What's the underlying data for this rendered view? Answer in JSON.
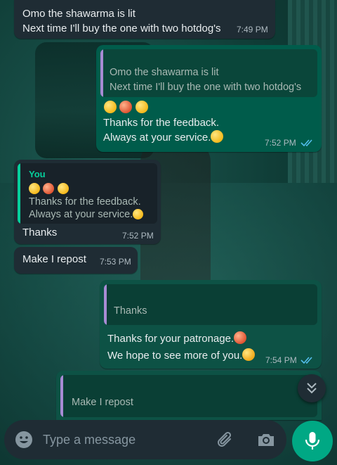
{
  "colors": {
    "incoming_bubble": "#1f2c34",
    "outgoing_bubble": "#005c4b",
    "quote_bar_purple": "#a78bd4",
    "quote_bar_teal": "#06cf9c",
    "read_ticks": "#53bdeb",
    "mic_button": "#00a884"
  },
  "messages": [
    {
      "id": "m1",
      "direction": "incoming",
      "lines": [
        "Omo the shawarma is lit",
        "Next time I'll buy the one with two hotdog's"
      ],
      "time": "7:49 PM"
    },
    {
      "id": "m2",
      "direction": "outgoing",
      "quote": {
        "lines": [
          "Omo the shawarma is lit",
          "Next time I'll buy the one with two hotdog's"
        ]
      },
      "emojis": [
        "star-struck-emoji",
        "heart-eyes-emoji",
        "star-struck-emoji"
      ],
      "lines": [
        "Thanks for the feedback.",
        "Always at your service."
      ],
      "trailing_emoji": "grinning-emoji",
      "time": "7:52 PM",
      "status": "read"
    },
    {
      "id": "m3",
      "direction": "incoming",
      "quote": {
        "author": "You",
        "emojis": [
          "star-struck-emoji",
          "heart-eyes-emoji",
          "star-struck-emoji"
        ],
        "lines": [
          "Thanks for the feedback.",
          "Always at your service."
        ],
        "trailing_emoji": "grinning-emoji"
      },
      "lines": [
        "Thanks"
      ],
      "time": "7:52 PM"
    },
    {
      "id": "m4",
      "direction": "incoming",
      "lines": [
        "Make I repost"
      ],
      "time": "7:53 PM"
    },
    {
      "id": "m5",
      "direction": "outgoing",
      "quote": {
        "lines": [
          "Thanks"
        ]
      },
      "lines": [
        "Thanks for your patronage.",
        "We hope to see more of you."
      ],
      "inline_emojis": [
        "handshake-emoji",
        "smiling-face-emoji"
      ],
      "time": "7:54 PM",
      "status": "read"
    },
    {
      "id": "m6",
      "direction": "outgoing",
      "quote": {
        "lines": [
          "Make I repost"
        ]
      }
    }
  ],
  "composer": {
    "placeholder": "Type a message",
    "icons": [
      "emoji-icon",
      "attach-icon",
      "camera-icon",
      "mic-icon"
    ]
  },
  "scroll_down_icon": "double-chevron-down-icon"
}
